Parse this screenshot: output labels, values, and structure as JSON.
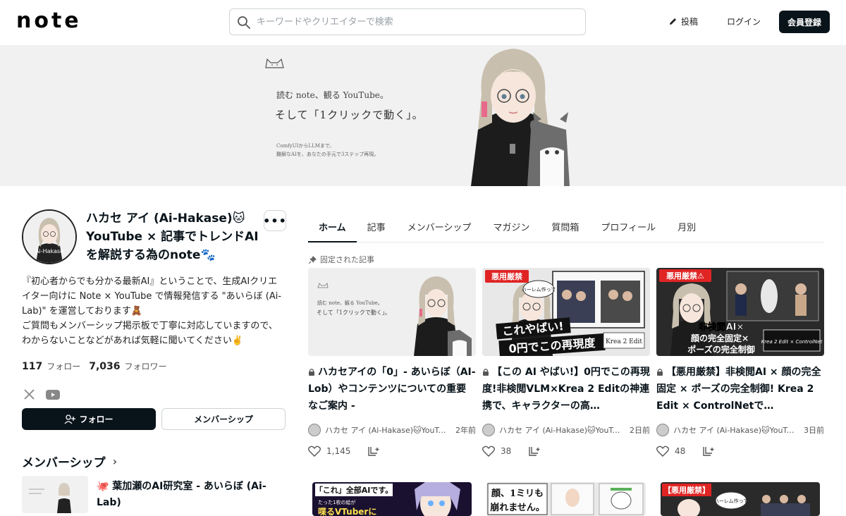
{
  "header": {
    "logo": "note",
    "search_placeholder": "キーワードやクリエイターで検索",
    "post_label": "投稿",
    "login_label": "ログイン",
    "register_label": "会員登録"
  },
  "banner": {
    "line1": "読む note、観る YouTube。",
    "line2": "そして「1クリックで動く」。",
    "line3": "ComfyUIからLLMまで、",
    "line4": "難解なAIを、あなたの手元で3ステップ再現。"
  },
  "profile": {
    "name": "ハカセ アイ (Ai-Hakase)🐱YouTube × 記事でトレンドAIを解説する為のnote🐾",
    "more": "•••",
    "bio": "『初心者からでも分かる最新AI』ということで、生成AIクリエイター向けに Note × YouTube で情報発信する \"あいらぼ (Ai-Lab)\" を運営しております🧸\nご質問もメンバーシップ掲示板で丁寧に対応していますので、わからないことなどがあれば気軽に聞いてください✌️",
    "follow_count": "117",
    "follow_label": "フォロー",
    "follower_count": "7,036",
    "follower_label": "フォロワー",
    "follow_button": "フォロー",
    "membership_button": "メンバーシップ"
  },
  "membership": {
    "heading": "メンバーシップ",
    "item_title": "🐙 葉加瀬のAI研究室 - あいらぼ (Ai-Lab)"
  },
  "tabs": [
    "ホーム",
    "記事",
    "メンバーシップ",
    "マガジン",
    "質問箱",
    "プロフィール",
    "月別"
  ],
  "pinned_label": "固定された記事",
  "cards": [
    {
      "title": "ハカセアイの「0」- あいらぼ（AI-Lob）やコンテンツについての重要なご案内 -",
      "author": "ハカセ アイ (Ai-Hakase)🐱YouTube × 記事でトレンドAI",
      "date": "2年前",
      "likes": "1,145"
    },
    {
      "title": "【この AI やばい!】0円でこの再現度!非検閲VLM×Krea 2 Editの神連携で、キャラクターの高…",
      "author": "ハカセ アイ (Ai-Hakase)🐱YouTube × 記事でトレンドAI",
      "date": "2日前",
      "likes": "38",
      "thumb_badge": "悪用厳禁",
      "thumb_line1": "これやばい!",
      "thumb_line2": "0円でこの再現度",
      "thumb_bubble": "ハーレム作って",
      "thumb_tag": "Krea 2 Edit"
    },
    {
      "title": "【悪用厳禁】非検閲AI × 顔の完全固定 × ポーズの完全制御! Krea 2 Edit × ControlNetで…",
      "author": "ハカセ アイ (Ai-Hakase)🐱YouTube × 記事でトレンドAI",
      "date": "3日前",
      "likes": "48",
      "thumb_badge": "悪用厳禁⚠",
      "thumb_line1": "非検閲AI×",
      "thumb_line2": "顔の完全固定×",
      "thumb_line3": "ポーズの完全制御",
      "thumb_tag": "Krea 2 Edit × ControlNet"
    }
  ],
  "row2": [
    {
      "text1": "「これ」全部AIです。",
      "text2": "たった1枚の絵が",
      "text3": "喋るVTuberに"
    },
    {
      "text1": "顔、1ミリも",
      "text2": "崩れません。"
    },
    {
      "text1": "【悪用厳禁】",
      "text2": "ハーレム作って"
    }
  ]
}
